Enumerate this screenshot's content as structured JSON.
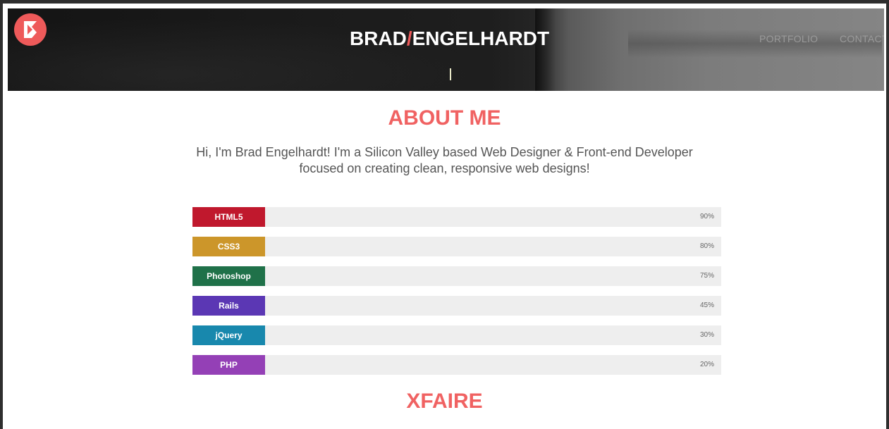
{
  "header": {
    "brand_first": "BRAD",
    "brand_slash": "/",
    "brand_last": "ENGELHARDT",
    "nav": {
      "portfolio": "PORTFOLIO",
      "contact": "CONTACT"
    },
    "logo_icon": "brand-logo-icon"
  },
  "about": {
    "title": "ABOUT ME",
    "intro_line1": "Hi, I'm Brad Engelhardt! I'm a Silicon Valley based Web Designer & Front-end Developer",
    "intro_line2": "focused on creating clean, responsive web designs!"
  },
  "skills": [
    {
      "label": "HTML5",
      "percent": "90%",
      "color": "#c0182d"
    },
    {
      "label": "CSS3",
      "percent": "80%",
      "color": "#cc962a"
    },
    {
      "label": "Photoshop",
      "percent": "75%",
      "color": "#1f7149"
    },
    {
      "label": "Rails",
      "percent": "45%",
      "color": "#5b37b4"
    },
    {
      "label": "jQuery",
      "percent": "30%",
      "color": "#1888ad"
    },
    {
      "label": "PHP",
      "percent": "20%",
      "color": "#9440b6"
    }
  ],
  "next_section": {
    "title": "XFAIRE"
  },
  "colors": {
    "accent": "#f06262",
    "track": "#eeeeee"
  }
}
